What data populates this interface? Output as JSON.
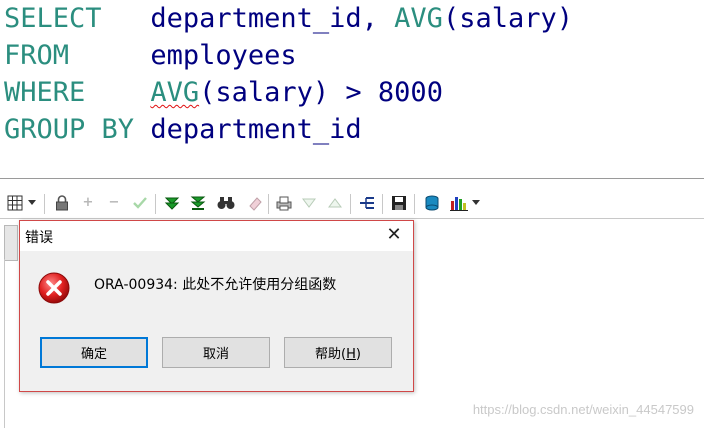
{
  "sql": {
    "line1": {
      "kw": "SELECT",
      "pad": "   ",
      "col": "department_id, ",
      "fn": "AVG",
      "arg": "(salary)"
    },
    "line2": {
      "kw": "FROM",
      "pad": "     ",
      "table": "employees"
    },
    "line3": {
      "kw": "WHERE",
      "pad": "    ",
      "fn": "AVG",
      "arg": "(salary)",
      "op": " > ",
      "num": "8000"
    },
    "line4": {
      "kw": "GROUP BY",
      "pad": " ",
      "col": "department_id"
    }
  },
  "toolbar": {
    "icons": [
      "grid-icon",
      "dropdown-arrow-icon",
      "lock-icon",
      "plus-icon",
      "minus-icon",
      "check-icon",
      "fetch-next-icon",
      "fetch-last-icon",
      "binoculars-icon",
      "eraser-icon",
      "print-icon",
      "triangle-down-icon",
      "triangle-up-icon",
      "tree-icon",
      "save-icon",
      "database-icon",
      "chart-icon",
      "dropdown-arrow-icon"
    ]
  },
  "dialog": {
    "title": "错误",
    "close_glyph": "✕",
    "message": "ORA-00934: 此处不允许使用分组函数",
    "buttons": {
      "ok": "确定",
      "cancel": "取消",
      "help_prefix": "帮助(",
      "help_key": "H",
      "help_suffix": ")"
    }
  },
  "watermark": "https://blog.csdn.net/weixin_44547599",
  "colors": {
    "keyword": "#2b8e7f",
    "identifier": "#00007f",
    "dialog_border": "#d04848",
    "default_button": "#0078d7"
  }
}
